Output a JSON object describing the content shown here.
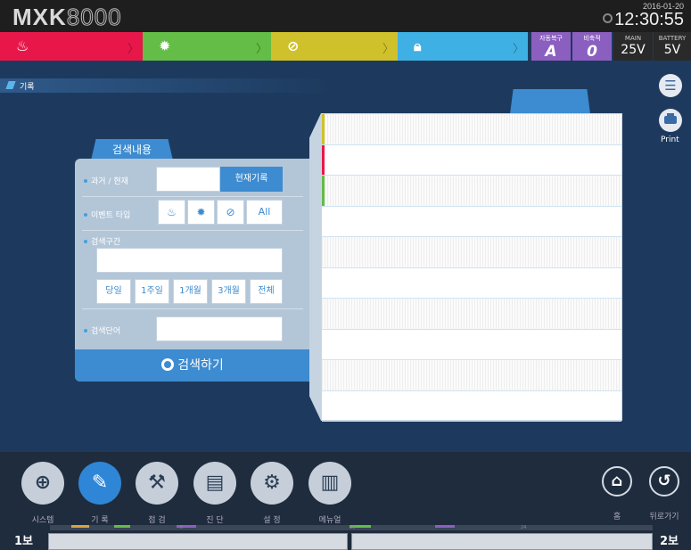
{
  "header": {
    "logo_main": "MXK",
    "logo_num": "8000",
    "date": "2016-01-20",
    "time": "12:30:55"
  },
  "status": {
    "fire_icon": "fire-icon",
    "fault_icon": "sun-fault-icon",
    "block_icon": "no-entry-icon",
    "lock_icon": "lock-icon",
    "auto_label": "자동복구",
    "auto_value": "A",
    "emerg_label": "비축적",
    "emerg_value": "0",
    "main_label": "MAIN",
    "main_value": "25V",
    "battery_label": "BATTERY",
    "battery_value": "5V",
    "colors": {
      "fire": "#e8174a",
      "fault": "#63bd46",
      "block": "#cfc12b",
      "lock": "#3fb0e4",
      "mode": "#8b5fbf"
    }
  },
  "breadcrumb": {
    "label": "기록"
  },
  "side_buttons": {
    "list_icon": "list-icon",
    "print_label": "Print"
  },
  "search": {
    "tab_label": "검색내용",
    "past_current_label": "과거 / 현재",
    "current_record_button": "현재기록",
    "event_type_label": "이벤트 타입",
    "event_all_button": "All",
    "range_label": "검색구간",
    "range_value": "",
    "period_buttons": [
      "당일",
      "1주일",
      "1개월",
      "3개월",
      "전체"
    ],
    "keyword_label": "검색단어",
    "keyword_value": "",
    "submit_label": "검색하기"
  },
  "records": {
    "rows": [
      {
        "flag": "#cfc12b"
      },
      {
        "flag": "#e8174a"
      },
      {
        "flag": "#63bd46"
      },
      {
        "flag": ""
      },
      {
        "flag": ""
      },
      {
        "flag": ""
      },
      {
        "flag": ""
      },
      {
        "flag": ""
      },
      {
        "flag": ""
      },
      {
        "flag": ""
      }
    ]
  },
  "nav": {
    "system": "시스템",
    "record": "기 록",
    "inspect": "점 검",
    "diagnose": "진 단",
    "settings": "설 정",
    "manual": "메뉴얼",
    "home": "홈",
    "back": "뒤로가기"
  },
  "timeline": {
    "left_label": "1보",
    "right_label": "2보",
    "ticks": [
      "8",
      "16",
      "24"
    ]
  }
}
